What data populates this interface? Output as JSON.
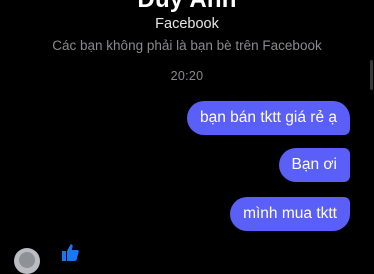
{
  "header": {
    "contact_name": "Duy Anh",
    "source": "Facebook",
    "notice": "Các bạn không phải là bạn bè trên Facebook"
  },
  "conversation": {
    "timestamp": "20:20",
    "messages": [
      {
        "sender": "me",
        "text": "bạn bán tktt giá rẻ ạ"
      },
      {
        "sender": "me",
        "text": "Bạn ơi"
      },
      {
        "sender": "me",
        "text": "mình mua tktt"
      }
    ]
  },
  "icons": {
    "avatar": "avatar",
    "reaction": "thumbs-up-icon"
  },
  "colors": {
    "background": "#000000",
    "bubble": "#5a5ff7",
    "accent": "#1877f2",
    "muted_text": "#8a8a8e"
  }
}
